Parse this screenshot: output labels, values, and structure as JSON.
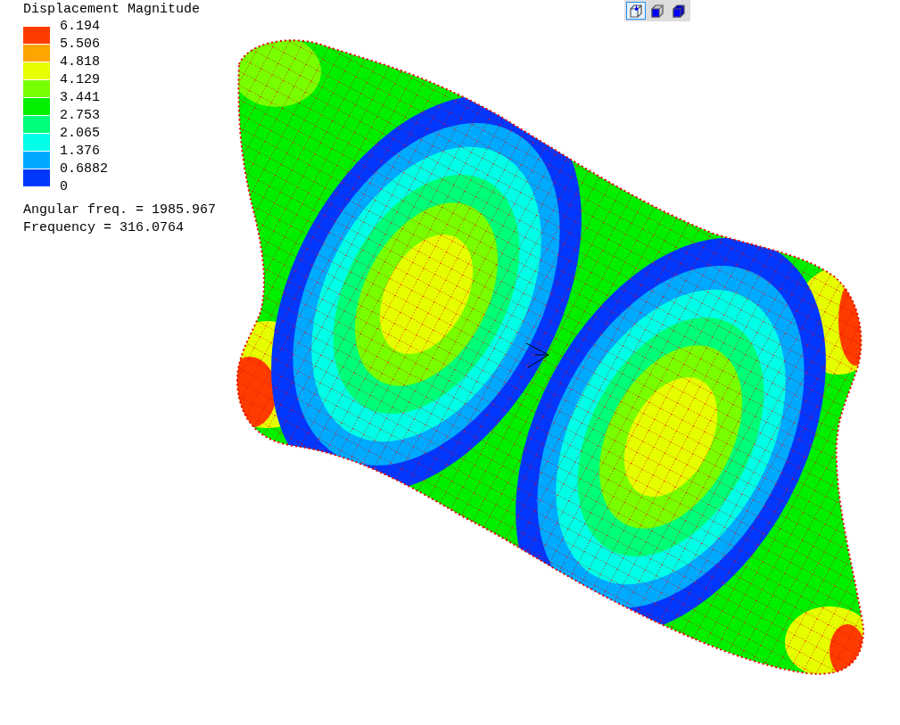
{
  "legend": {
    "title": "Displacement Magnitude",
    "ticks": [
      "6.194",
      "5.506",
      "4.818",
      "4.129",
      "3.441",
      "2.753",
      "2.065",
      "1.376",
      "0.6882",
      "0"
    ],
    "bands": [
      {
        "color": "#ff3c00"
      },
      {
        "color": "#ffa500"
      },
      {
        "color": "#e6ff00"
      },
      {
        "color": "#78ff00"
      },
      {
        "color": "#00f000"
      },
      {
        "color": "#00ff78"
      },
      {
        "color": "#00ffe6"
      },
      {
        "color": "#00aaff"
      },
      {
        "color": "#0037ff"
      }
    ]
  },
  "info": [
    "Angular freq. = 1985.967",
    "Frequency = 316.0764"
  ],
  "toolbar": [
    {
      "kind": "wireframe",
      "selected": true
    },
    {
      "kind": "solid",
      "selected": false
    },
    {
      "kind": "filled",
      "selected": false
    }
  ]
}
